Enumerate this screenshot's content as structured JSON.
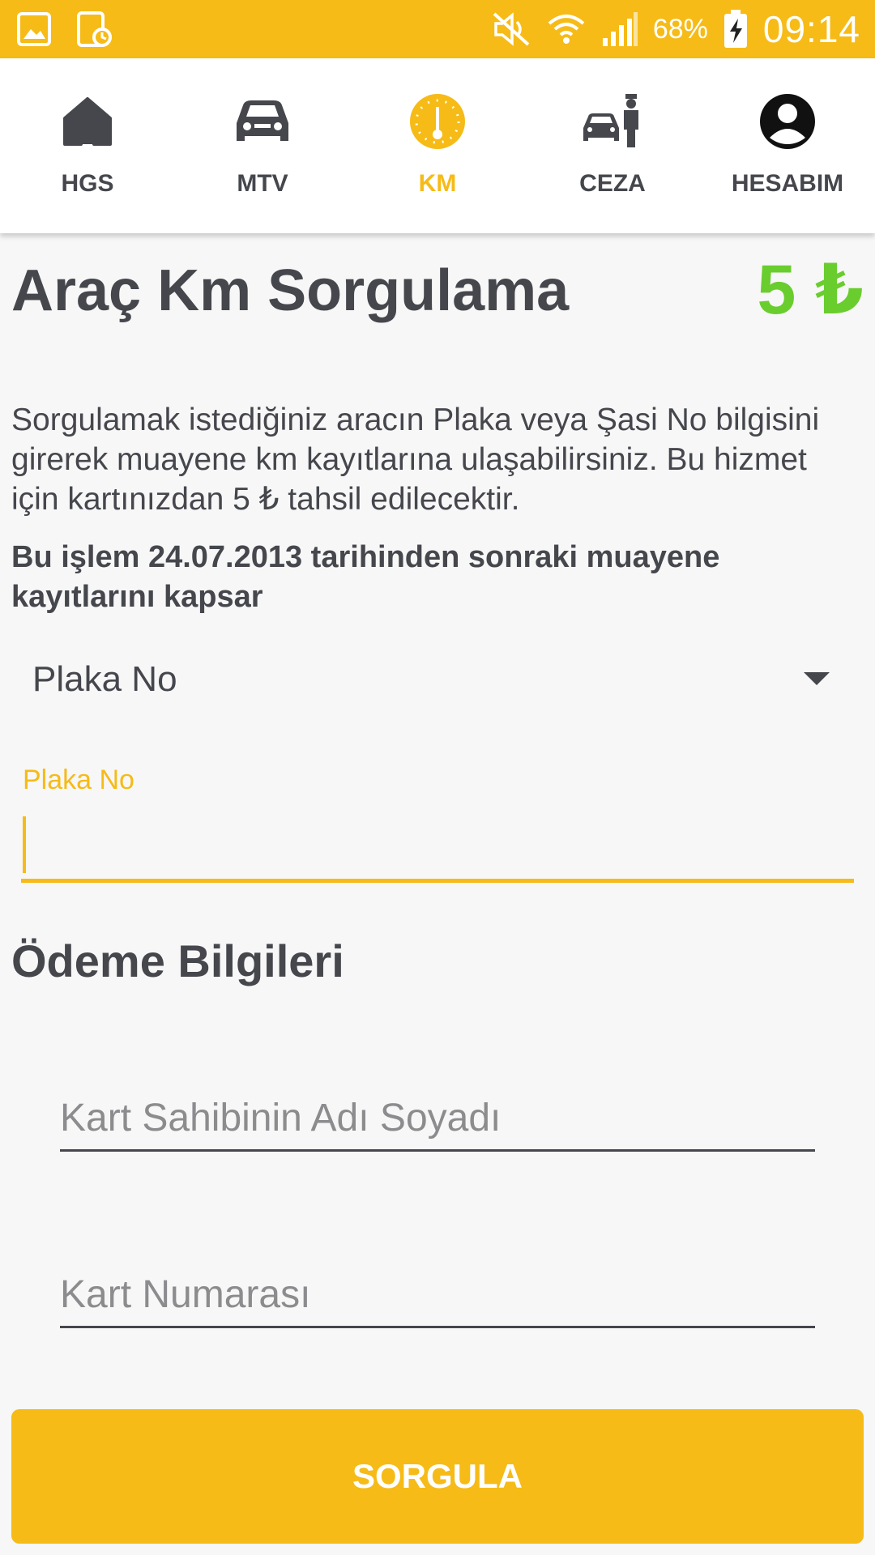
{
  "colors": {
    "accent": "#f6bb17",
    "text": "#45474d",
    "price": "#6acd2e",
    "background": "#f7f7f7",
    "placeholder": "#8c8c8f"
  },
  "status_bar": {
    "left_icons": [
      "gallery-icon",
      "screenshot-clock-icon"
    ],
    "right_icons": [
      "mute-icon",
      "wifi-icon",
      "signal-icon",
      "battery-charging-icon"
    ],
    "battery": "68%",
    "time": "09:14"
  },
  "nav": {
    "items": [
      {
        "label": "HGS",
        "icon": "home-icon",
        "active": false
      },
      {
        "label": "MTV",
        "icon": "car-icon",
        "active": false
      },
      {
        "label": "KM",
        "icon": "speedometer-icon",
        "active": true
      },
      {
        "label": "CEZA",
        "icon": "police-car-icon",
        "active": false
      },
      {
        "label": "HESABIM",
        "icon": "account-icon",
        "active": false
      }
    ]
  },
  "page": {
    "title": "Araç Km Sorgulama",
    "price": "5 ₺",
    "description": "Sorgulamak istediğiniz aracın Plaka veya Şasi No bilgisini girerek muayene km kayıtlarına ulaşabilirsiniz. Bu hizmet için kartınızdan 5 ₺ tahsil edilecektir.",
    "notice": "Bu işlem 24.07.2013 tarihinden sonraki muayene kayıtlarını kapsar"
  },
  "query_type": {
    "selected": "Plaka No"
  },
  "plate_field": {
    "label": "Plaka No",
    "value": ""
  },
  "payment": {
    "title": "Ödeme Bilgileri",
    "cardholder_placeholder": "Kart Sahibinin Adı Soyadı",
    "card_number_placeholder": "Kart Numarası"
  },
  "submit": {
    "label": "SORGULA"
  }
}
